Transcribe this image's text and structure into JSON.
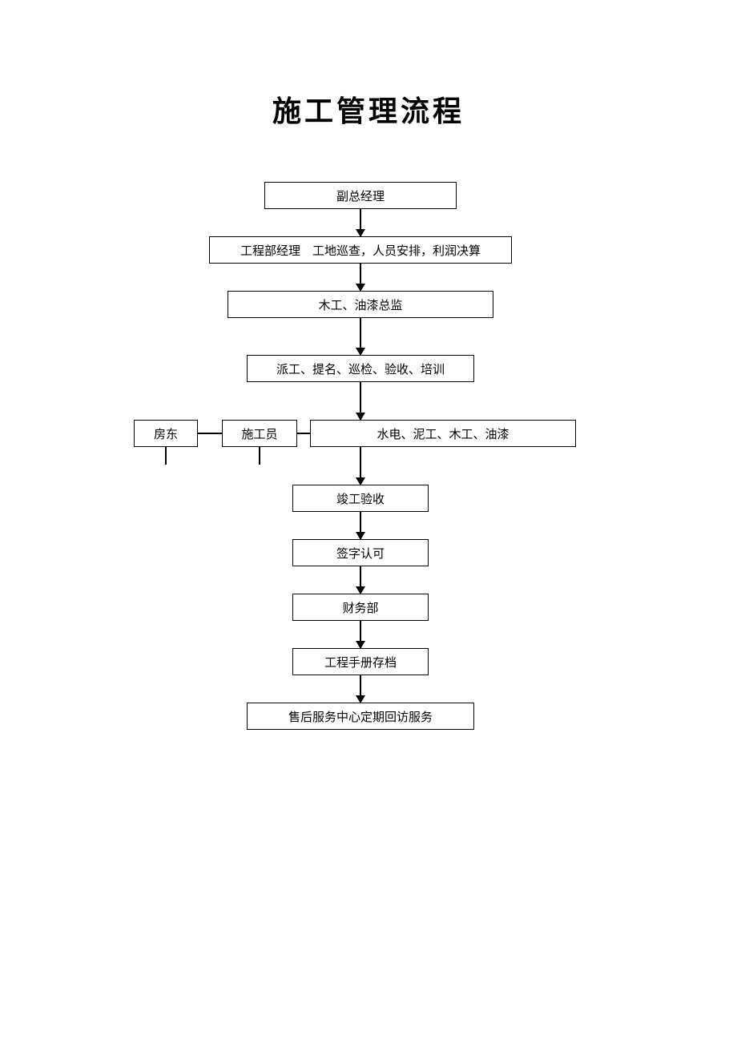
{
  "title": "施工管理流程",
  "boxes": {
    "b1": "副总经理",
    "b2": "工程部经理　工地巡查，人员安排，利润决算",
    "b3": "木工、油漆总监",
    "b4": "派工、提名、巡检、验收、培训",
    "b5a": "房东",
    "b5b": "施工员",
    "b5c": "水电、泥工、木工、油漆",
    "b6": "竣工验收",
    "b7": "签字认可",
    "b8": "财务部",
    "b9": "工程手册存档",
    "b10": "售后服务中心定期回访服务"
  }
}
